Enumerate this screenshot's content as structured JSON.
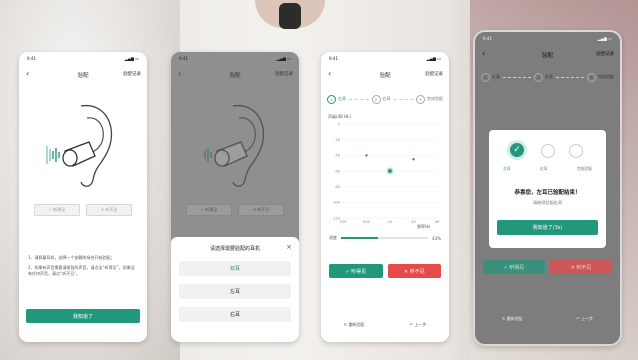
{
  "colors": {
    "accent": "#23977c",
    "danger": "#e84a4a"
  },
  "status_time": "9:41",
  "screen1": {
    "title": "验配",
    "record": "验配记录",
    "hear_label": "✓ 听得见",
    "not_hear_label": "✕ 听不见",
    "instructions": [
      "1、请佩戴耳机，选择一个安静的场合开始验配；",
      "2、如果有声音需要请按钮的声音，请点击“听得见”，如果没有任何声音，请点“听不见”。"
    ],
    "button": "我知道了"
  },
  "screen2": {
    "title": "验配",
    "record": "验配记录",
    "sheet_title": "请选择需要验配的耳机",
    "options": [
      "双耳",
      "左耳",
      "右耳"
    ]
  },
  "screen3": {
    "title": "验配",
    "record": "验配记录",
    "steps": [
      "左耳",
      "右耳",
      "完成验配"
    ],
    "chart_ylabel": "声级(dB HL)",
    "chart_xlabel": "频率Hz",
    "progress_label": "进度",
    "progress_value": "43%",
    "hear": "✓ 听得见",
    "not_hear": "✕ 听不见",
    "reset": "重新验配",
    "prev": "上一步"
  },
  "screen4": {
    "title": "验配",
    "record": "验配记录",
    "steps": [
      "左耳",
      "右耳",
      "完成验配"
    ],
    "modal_title": "恭喜您，左耳已验配结束！",
    "modal_sub": "请继续验配右耳",
    "modal_button": "我知道了(3s)",
    "hear": "✓ 听得见",
    "not_hear": "✕ 听不见",
    "reset": "重新验配",
    "prev": "上一步"
  },
  "chart_data": {
    "type": "scatter",
    "ylabel": "声级(dB HL)",
    "xlabel": "频率Hz",
    "x": [
      "250",
      "500",
      "1K",
      "2K",
      "4K"
    ],
    "y_ticks": [
      0,
      20,
      40,
      60,
      80,
      100,
      120
    ],
    "points": [
      {
        "x": "500",
        "y": 40
      },
      {
        "x": "1K",
        "y": 60
      },
      {
        "x": "2K",
        "y": 45
      }
    ],
    "progress": 0.43
  }
}
